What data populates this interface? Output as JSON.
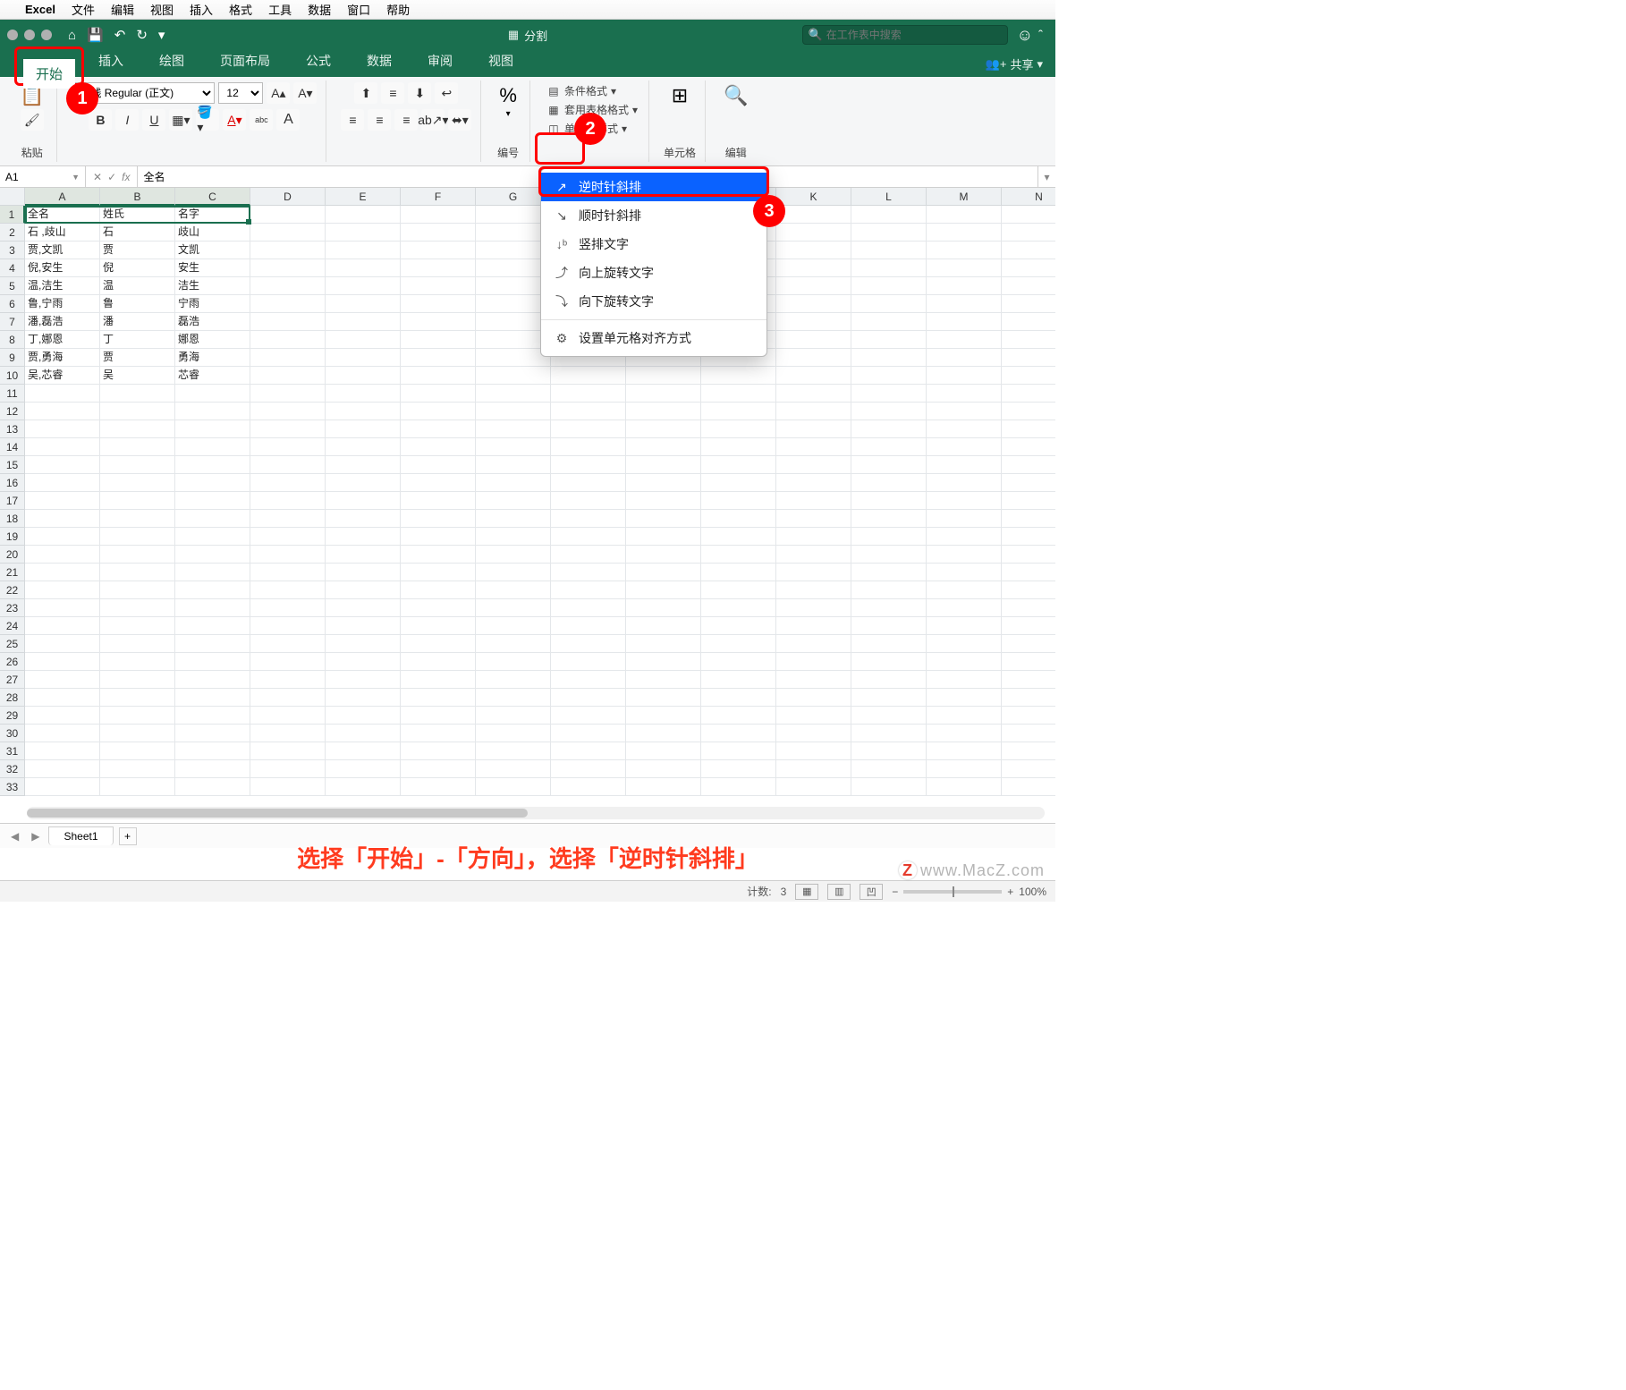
{
  "mac_menu": {
    "app": "Excel",
    "items": [
      "文件",
      "编辑",
      "视图",
      "插入",
      "格式",
      "工具",
      "数据",
      "窗口",
      "帮助"
    ]
  },
  "titlebar": {
    "doc": "分割",
    "search_placeholder": "在工作表中搜索"
  },
  "ribbon_tabs": [
    "开始",
    "插入",
    "绘图",
    "页面布局",
    "公式",
    "数据",
    "审阅",
    "视图"
  ],
  "share": "共享",
  "ribbon": {
    "paste": "粘贴",
    "font_name": "等线 Regular (正文)",
    "font_size": "12",
    "number": "编号",
    "cond_fmt": "条件格式",
    "table_fmt": "套用表格格式",
    "cell_style": "单元格样式",
    "cells": "单元格",
    "editing": "编辑"
  },
  "namebox": "A1",
  "formula": "全名",
  "columns": [
    "A",
    "B",
    "C",
    "D",
    "E",
    "F",
    "G",
    "H",
    "I",
    "J",
    "K",
    "L",
    "M",
    "N"
  ],
  "rows": 33,
  "data": [
    [
      "全名",
      "姓氏",
      "名字"
    ],
    [
      "石 ,歧山",
      "石",
      "歧山"
    ],
    [
      "贾,文凯",
      "贾",
      "文凯"
    ],
    [
      "倪,安生",
      "倪",
      "安生"
    ],
    [
      "温,洁生",
      "温",
      "洁生"
    ],
    [
      "鲁,宁雨",
      "鲁",
      "宁雨"
    ],
    [
      "潘,磊浩",
      "潘",
      "磊浩"
    ],
    [
      "丁,娜恩",
      "丁",
      "娜恩"
    ],
    [
      "贾,勇海",
      "贾",
      "勇海"
    ],
    [
      "吴,芯睿",
      "吴",
      "芯睿"
    ]
  ],
  "orient_menu": {
    "items": [
      "逆时针斜排",
      "顺时针斜排",
      "竖排文字",
      "向上旋转文字",
      "向下旋转文字"
    ],
    "settings": "设置单元格对齐方式"
  },
  "sheet": {
    "name": "Sheet1"
  },
  "status": {
    "count_label": "计数:",
    "count": "3",
    "zoom": "100%"
  },
  "caption": "选择「开始」-「方向」，选择「逆时针斜排」",
  "watermark": "www.MacZ.com",
  "callouts": {
    "n1": "1",
    "n2": "2",
    "n3": "3"
  }
}
